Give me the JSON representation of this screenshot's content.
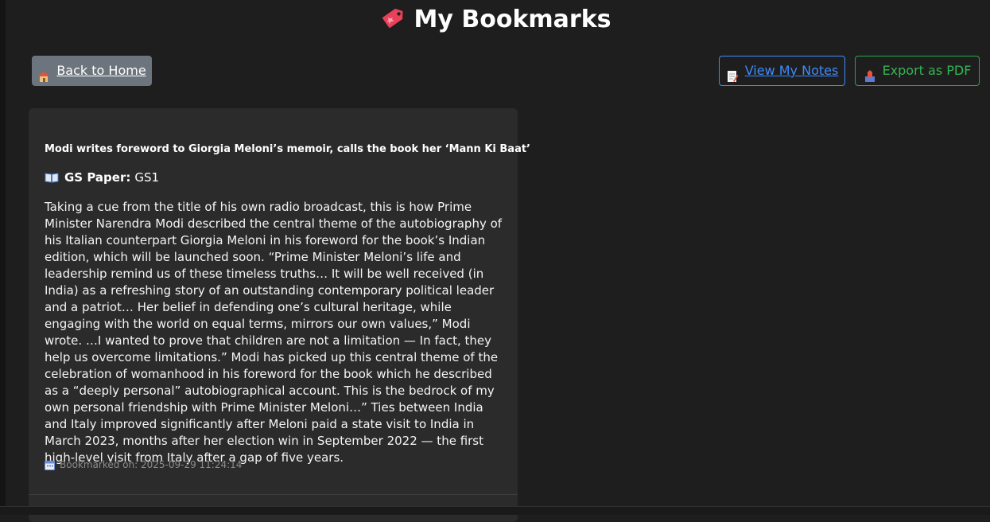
{
  "header": {
    "title": "My Bookmarks",
    "title_icon": "bookmark-tag-icon"
  },
  "toolbar": {
    "back_label": "Back to Home",
    "back_icon": "house-icon",
    "notes_label": "View My Notes",
    "notes_icon": "memo-icon",
    "export_label": "Export as PDF",
    "export_icon": "outbox-tray-icon"
  },
  "colors": {
    "background": "#1e1e1e",
    "card": "#2b2b2b",
    "secondary_button": "#6c757d",
    "primary_outline": "#3d8bfd",
    "success_outline": "#28a745"
  },
  "bookmarks": [
    {
      "title": "Modi writes foreword to Giorgia Meloni’s memoir, calls the book her ‘Mann Ki Baat’",
      "gs_label": "GS Paper:",
      "gs_value": "GS1",
      "body": "Taking a cue from the title of his own radio broadcast, this is how Prime Minister Narendra Modi described the central theme of the autobiography of his Italian counterpart Giorgia Meloni in his foreword for the book’s Indian edition, which will be launched soon. “Prime Minister Meloni’s life and leadership remind us of these timeless truths… It will be well received (in India) as a refreshing story of an outstanding contemporary political leader and a patriot… Her belief in defending one’s cultural heritage, while engaging with the world on equal terms, mirrors our own values,” Modi wrote. …I wanted to prove that children are not a limitation — In fact, they help us overcome limitations.” Modi has picked up this central theme of the celebration of womanhood in his foreword for the book which he described as a “deeply personal” autobiographical account. This is the bedrock of my own personal friendship with Prime Minister Meloni…” Ties between India and Italy improved significantly after Meloni paid a state visit to India in March 2023, months after her election win in September 2022 — the first high-level visit from Italy after a gap of five years.",
      "bookmarked_on": "Bookmarked on: 2025-09-29 11:24:14"
    }
  ]
}
